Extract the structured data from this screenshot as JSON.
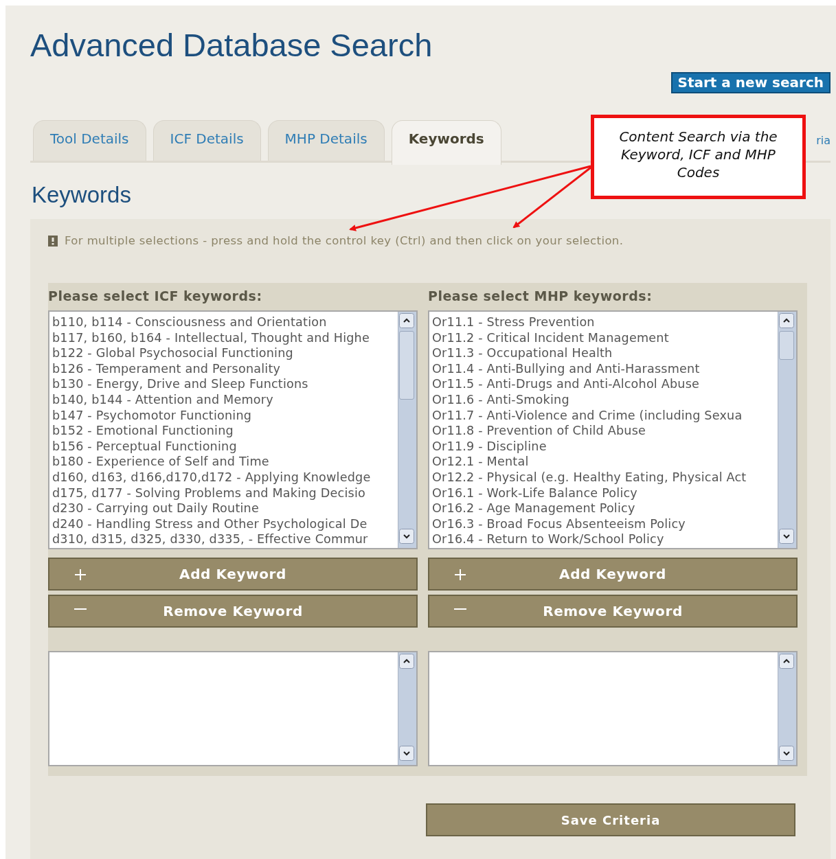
{
  "title": "Advanced Database Search",
  "new_search_button": "Start a new search",
  "tabs": [
    {
      "label": "Tool Details",
      "selected": false
    },
    {
      "label": "ICF Details",
      "selected": false
    },
    {
      "label": "MHP Details",
      "selected": false
    },
    {
      "label": "Keywords",
      "selected": true
    },
    {
      "label": "ria",
      "selected": false
    }
  ],
  "callout": {
    "text": "Content Search via the Keyword, ICF and MHP Codes"
  },
  "section_title": "Keywords",
  "notice": "For multiple selections - press and hold the control key (Ctrl) and then click on your selection.",
  "columns": [
    {
      "heading": "Please select ICF keywords:",
      "items": [
        "b110, b114 - Consciousness and Orientation",
        "b117, b160, b164 - Intellectual, Thought and Highe",
        "b122 - Global Psychosocial Functioning",
        "b126 - Temperament and Personality",
        "b130 - Energy, Drive and Sleep Functions",
        "b140, b144 - Attention and Memory",
        "b147 - Psychomotor Functioning",
        "b152 - Emotional Functioning",
        "b156 - Perceptual Functioning",
        "b180 - Experience of Self and Time",
        "d160, d163, d166,d170,d172 - Applying Knowledge",
        "d175, d177 - Solving Problems and Making Decisio",
        "d230 - Carrying out Daily Routine",
        "d240 - Handling Stress and Other Psychological De",
        "d310, d315, d325, d330, d335, - Effective Commur"
      ],
      "add_button": "Add Keyword",
      "remove_button": "Remove Keyword"
    },
    {
      "heading": "Please select MHP keywords:",
      "items": [
        "Or11.1 - Stress Prevention",
        "Or11.2 - Critical Incident Management",
        "Or11.3 - Occupational Health",
        "Or11.4 - Anti-Bullying and Anti-Harassment",
        "Or11.5 - Anti-Drugs and Anti-Alcohol Abuse",
        "Or11.6 - Anti-Smoking",
        "Or11.7 - Anti-Violence and Crime (including Sexua",
        "Or11.8 - Prevention of Child Abuse",
        "Or11.9 - Discipline",
        "Or12.1 - Mental",
        "Or12.2 - Physical (e.g. Healthy Eating, Physical Act",
        "Or16.1 - Work-Life Balance Policy",
        "Or16.2 - Age Management Policy",
        "Or16.3 - Broad Focus Absenteeism Policy",
        "Or16.4 - Return to Work/School Policy"
      ],
      "add_button": "Add Keyword",
      "remove_button": "Remove Keyword"
    }
  ],
  "save_button": "Save Criteria"
}
